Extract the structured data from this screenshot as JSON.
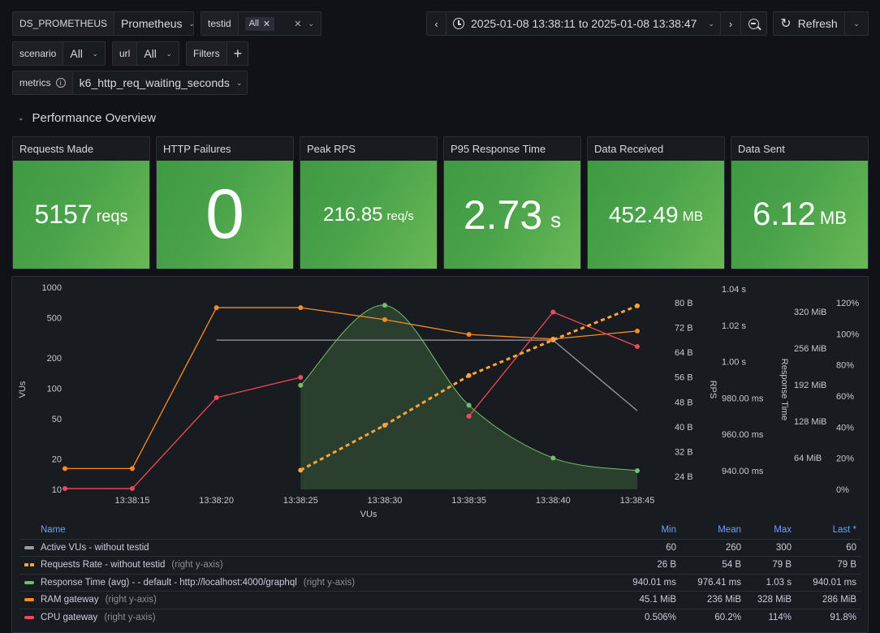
{
  "variables": {
    "datasource": {
      "label": "DS_PROMETHEUS",
      "value": "Prometheus"
    },
    "testid": {
      "label": "testid",
      "chip": "All"
    },
    "scenario": {
      "label": "scenario",
      "value": "All"
    },
    "url": {
      "label": "url",
      "value": "All"
    },
    "filters": {
      "label": "Filters",
      "add": "+"
    },
    "metrics": {
      "label": "metrics",
      "value": "k6_http_req_waiting_seconds"
    }
  },
  "timepicker": {
    "range": "2025-01-08 13:38:11 to 2025-01-08 13:38:47",
    "refresh_label": "Refresh"
  },
  "row": {
    "title": "Performance Overview"
  },
  "stats": [
    {
      "title": "Requests Made",
      "value": "5157",
      "unit": "reqs"
    },
    {
      "title": "HTTP Failures",
      "value": "0",
      "unit": ""
    },
    {
      "title": "Peak RPS",
      "value": "216.85",
      "unit": "req/s"
    },
    {
      "title": "P95 Response Time",
      "value": "2.73",
      "unit": "s"
    },
    {
      "title": "Data Received",
      "value": "452.49",
      "unit": "MB"
    },
    {
      "title": "Data Sent",
      "value": "6.12",
      "unit": "MB"
    }
  ],
  "chart_data": {
    "type": "line",
    "xlabel": "VUs",
    "x_ticks": [
      "13:38:15",
      "13:38:20",
      "13:38:25",
      "13:38:30",
      "13:38:35",
      "13:38:40",
      "13:38:45"
    ],
    "x_range_seconds": [
      11,
      45
    ],
    "axes": {
      "vus": {
        "label": "VUs",
        "scale": "log",
        "range": [
          10,
          1000
        ],
        "ticks": [
          "1000",
          "500",
          "200",
          "100",
          "50",
          "20",
          "10"
        ],
        "tick_values": [
          1000,
          500,
          200,
          100,
          50,
          20,
          10
        ],
        "side": "left"
      },
      "bytes": {
        "label": "RPS",
        "range": [
          24,
          80
        ],
        "ticks": [
          "80 B",
          "72 B",
          "64 B",
          "56 B",
          "48 B",
          "40 B",
          "32 B",
          "24 B"
        ],
        "tick_values": [
          80,
          72,
          64,
          56,
          48,
          40,
          32,
          24
        ],
        "side": "right"
      },
      "time": {
        "label": "Response Time",
        "range_ms": [
          940,
          1040
        ],
        "ticks": [
          "1.04 s",
          "1.02 s",
          "1.00 s",
          "980.00 ms",
          "960.00 ms",
          "940.00 ms"
        ],
        "tick_values": [
          1040,
          1020,
          1000,
          980,
          960,
          940
        ],
        "side": "right"
      },
      "mem": {
        "label": "",
        "range": [
          64,
          320
        ],
        "ticks": [
          "320 MiB",
          "256 MiB",
          "192 MiB",
          "128 MiB",
          "64 MiB"
        ],
        "tick_values": [
          320,
          256,
          192,
          128,
          64
        ],
        "side": "right"
      },
      "pct": {
        "label": "",
        "range": [
          0,
          120
        ],
        "ticks": [
          "120%",
          "100%",
          "80%",
          "60%",
          "40%",
          "20%",
          "0%"
        ],
        "tick_values": [
          120,
          100,
          80,
          60,
          40,
          20,
          0
        ],
        "side": "right"
      }
    },
    "series": [
      {
        "name": "Active VUs - without testid",
        "axis": "vus",
        "color": "#9a9aa2",
        "style": "solid",
        "points": [
          [
            20,
            300
          ],
          [
            40,
            300
          ],
          [
            45,
            60
          ]
        ]
      },
      {
        "name": "Requests Rate - without testid",
        "axis": "bytes",
        "color": "#ffa53a",
        "style": "dashed",
        "points": [
          [
            25,
            26
          ],
          [
            30,
            40.5
          ],
          [
            35,
            56.5
          ],
          [
            40,
            68
          ],
          [
            45,
            79
          ]
        ]
      },
      {
        "name": "Response Time (avg) - - default - http://localhost:4000/graphql",
        "axis": "time",
        "color": "#73bf69",
        "style": "area-smooth",
        "points": [
          [
            25,
            987
          ],
          [
            30,
            1031
          ],
          [
            35,
            976
          ],
          [
            40,
            947
          ],
          [
            45,
            940
          ]
        ]
      },
      {
        "name": "RAM gateway",
        "axis": "mem",
        "color": "#ff8a1f",
        "style": "solid",
        "points": [
          [
            11,
            45
          ],
          [
            15,
            45
          ],
          [
            20,
            327
          ],
          [
            25,
            327
          ],
          [
            30,
            306
          ],
          [
            35,
            280
          ],
          [
            40,
            272
          ],
          [
            45,
            286
          ]
        ]
      },
      {
        "name": "CPU gateway",
        "axis": "pct",
        "color": "#f2495c",
        "style": "solid",
        "segments": [
          [
            [
              11,
              0.5
            ],
            [
              15,
              0.5
            ],
            [
              20,
              59
            ],
            [
              25,
              72
            ]
          ],
          [
            [
              35,
              47
            ],
            [
              40,
              114
            ],
            [
              45,
              91.8
            ]
          ]
        ]
      }
    ]
  },
  "legend": {
    "headers": {
      "name": "Name",
      "min": "Min",
      "mean": "Mean",
      "max": "Max",
      "last": "Last *"
    },
    "rows": [
      {
        "name": "Active VUs - without testid",
        "suffix": "",
        "color": "#9a9aa2",
        "dashed": false,
        "min": "60",
        "mean": "260",
        "max": "300",
        "last": "60"
      },
      {
        "name": "Requests Rate - without testid",
        "suffix": "(right y-axis)",
        "color": "#ffa53a",
        "dashed": true,
        "min": "26 B",
        "mean": "54 B",
        "max": "79 B",
        "last": "79 B"
      },
      {
        "name": "Response Time (avg) - - default - http://localhost:4000/graphql",
        "suffix": "(right y-axis)",
        "color": "#73bf69",
        "dashed": false,
        "min": "940.01 ms",
        "mean": "976.41 ms",
        "max": "1.03 s",
        "last": "940.01 ms"
      },
      {
        "name": "RAM gateway",
        "suffix": "(right y-axis)",
        "color": "#ff8a1f",
        "dashed": false,
        "min": "45.1 MiB",
        "mean": "236 MiB",
        "max": "328 MiB",
        "last": "286 MiB"
      },
      {
        "name": "CPU gateway",
        "suffix": "(right y-axis)",
        "color": "#f2495c",
        "dashed": false,
        "min": "0.506%",
        "mean": "60.2%",
        "max": "114%",
        "last": "91.8%"
      }
    ]
  }
}
